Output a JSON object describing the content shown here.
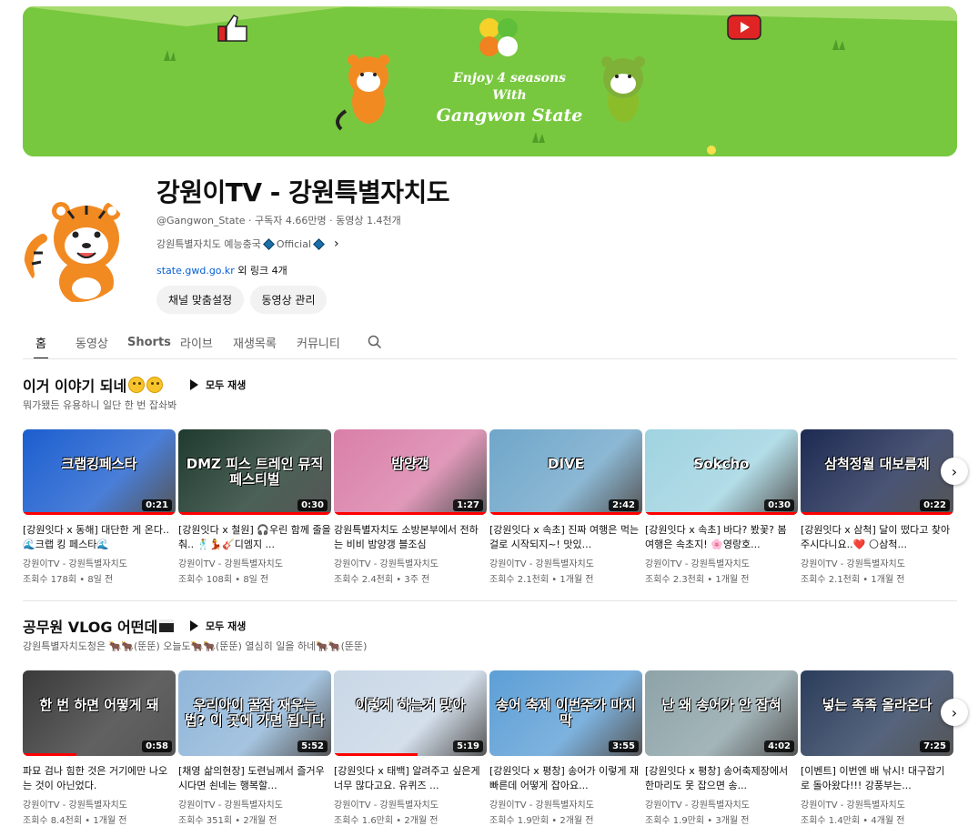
{
  "banner": {
    "line1": "Enjoy 4 seasons",
    "line2": "With",
    "line3": "Gangwon State",
    "bg_color": "#78c83f"
  },
  "channel": {
    "name": "강원이TV - 강원특별자치도",
    "handle": "@Gangwon_State",
    "subscribers": "구독자 4.66만명",
    "videos": "동영상 1.4천개",
    "meta_sep": "‧",
    "description": "강원특별자치도 예능충국",
    "official": "Official",
    "link_url": "state.gwd.go.kr",
    "link_more": "외 링크 4개",
    "customize_label": "채널 맞춤설정",
    "manage_label": "동영상 관리"
  },
  "tabs": [
    {
      "label": "홈",
      "active": true
    },
    {
      "label": "동영상"
    },
    {
      "label": "Shorts"
    },
    {
      "label": "라이브"
    },
    {
      "label": "재생목록"
    },
    {
      "label": "커뮤니티"
    }
  ],
  "sections": [
    {
      "title": "이거 이야기 되네",
      "play_all": "모두 재생",
      "subtitle": "뭐가됐든 유용하니 일단 한 번 잡솨봐",
      "videos": [
        {
          "title": "[강원잇다 x 동해] 대단한 게 온다.. 🌊크랩 킹 페스타🌊",
          "channel": "강원이TV - 강원특별자치도",
          "stats": "조회수 178회 • 8일 전",
          "duration": "0:21",
          "caption": "크랩킹페스타",
          "progress": 1.0,
          "color": "#1c5ecf"
        },
        {
          "title": "[강원잇다 x 철원] 🎧우린 함께 줄을 춰.. 🕺💃🎸디엠지 ...",
          "channel": "강원이TV - 강원특별자치도",
          "stats": "조회수 108회 • 8일 전",
          "duration": "0:30",
          "caption": "DMZ 피스 트레인 뮤직 페스티벌",
          "progress": 1.0,
          "color": "#1f3a2e"
        },
        {
          "title": "강원특별자치도 소방본부에서 전하는 비비 밤양갱 블조심",
          "channel": "강원이TV - 강원특별자치도",
          "stats": "조회수 2.4천회 • 3주 전",
          "duration": "1:27",
          "caption": "밤양갱",
          "progress": 1.0,
          "color": "#d97fa8"
        },
        {
          "title": "[강원잇다 x 속초] 진짜 여행은 먹는 걸로 시작되지~! 맛있...",
          "channel": "강원이TV - 강원특별자치도",
          "stats": "조회수 2.1천회 • 1개월 전",
          "duration": "2:42",
          "caption": "DIVE",
          "progress": 1.0,
          "color": "#6fa6c9"
        },
        {
          "title": "[강원잇다 x 속초] 바다? 봤꽃? 봄 여행은 속초지! 🌸영랑호...",
          "channel": "강원이TV - 강원특별자치도",
          "stats": "조회수 2.3천회 • 1개월 전",
          "duration": "0:30",
          "caption": "Sokcho",
          "progress": 1.0,
          "color": "#9fd3e0"
        },
        {
          "title": "[강원잇다 x 삼척] 달이 떴다고 찾아주시다니요..❤️ 🌕삼척...",
          "channel": "강원이TV - 강원특별자치도",
          "stats": "조회수 2.1천회 • 1개월 전",
          "duration": "0:22",
          "caption": "삼척정월 대보름제",
          "progress": 1.0,
          "color": "#1d2a52"
        }
      ]
    },
    {
      "title": "공무원 VLOG 어떤데",
      "play_all": "모두 재생",
      "subtitle": "강원특별자치도청은 🐂🐂(뚠뚠) 오늘도🐂🐂(뚠뚠) 열심히 일을 하네🐂🐂(뚠뚠)",
      "videos": [
        {
          "title": "파묘 검나 힘한 것은 거기에만 나오는 것이 아닌었다.",
          "channel": "강원이TV - 강원특별자치도",
          "stats": "조회수 8.4천회 • 1개월 전",
          "duration": "0:58",
          "caption": "한 번 하면 어떻게 돼",
          "progress": 0.35,
          "color": "#3a3a3a"
        },
        {
          "title": "[채영 삶의현장] 도련님께서 즐거우시다면 쇤네는 행복할...",
          "channel": "강원이TV - 강원특별자치도",
          "stats": "조회수 351회 • 2개월 전",
          "duration": "5:52",
          "caption": "우리아이 꿀잠 재우는법? 이 곳에 가면 됩니다",
          "progress": 0.0,
          "color": "#8fb5d8"
        },
        {
          "title": "[강원잇다 x 태백] 알려주고 싶은게 너무 많다고요. 유퀴즈 ...",
          "channel": "강원이TV - 강원특별자치도",
          "stats": "조회수 1.6만회 • 2개월 전",
          "duration": "5:19",
          "caption": "이렇게 하는거 맞아",
          "progress": 0.55,
          "color": "#c9d7e6"
        },
        {
          "title": "[강원잇다 x 평창] 송어가 이렇게 재빠른데 어떻게 잡아요...",
          "channel": "강원이TV - 강원특별자치도",
          "stats": "조회수 1.9만회 • 2개월 전",
          "duration": "3:55",
          "caption": "송어 축제 이번주가 마지막",
          "progress": 0.0,
          "color": "#5d9fd6"
        },
        {
          "title": "[강원잇다 x 평창] 송어축제장에서 한마리도 못 잡으면 송...",
          "channel": "강원이TV - 강원특별자치도",
          "stats": "조회수 1.9만회 • 3개월 전",
          "duration": "4:02",
          "caption": "난 왜 송어가 안 잡혀",
          "progress": 0.0,
          "color": "#8da3a8"
        },
        {
          "title": "[이벤트] 이번엔 배 낚시! 대구잡기로 돌아왔다!!! 강풍부는...",
          "channel": "강원이TV - 강원특별자치도",
          "stats": "조회수 1.4만회 • 4개월 전",
          "duration": "7:25",
          "caption": "넣는 족족 올라온다",
          "progress": 0.0,
          "color": "#2b3d5c"
        }
      ]
    }
  ]
}
